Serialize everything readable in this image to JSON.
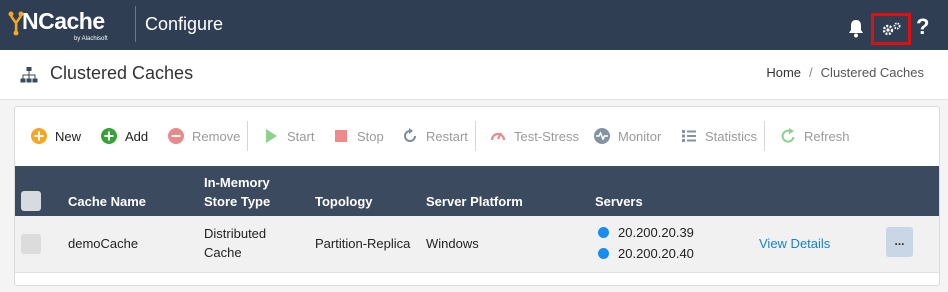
{
  "topbar": {
    "logo_text": "NCache",
    "logo_sub": "by Alachisoft",
    "app_title": "Configure",
    "help_label": "?"
  },
  "page": {
    "title": "Clustered Caches",
    "breadcrumb": {
      "home": "Home",
      "separator": "/",
      "current": "Clustered Caches"
    }
  },
  "toolbar": {
    "new": "New",
    "add": "Add",
    "remove": "Remove",
    "start": "Start",
    "stop": "Stop",
    "restart": "Restart",
    "test_stress": "Test-Stress",
    "monitor": "Monitor",
    "statistics": "Statistics",
    "refresh": "Refresh"
  },
  "table": {
    "headers": {
      "cache_name": "Cache Name",
      "store_type_1": "In-Memory",
      "store_type_2": "Store Type",
      "topology": "Topology",
      "server_platform": "Server Platform",
      "servers": "Servers"
    },
    "rows": [
      {
        "cache_name": "demoCache",
        "store_type_1": "Distributed",
        "store_type_2": "Cache",
        "topology": "Partition-Replica",
        "server_platform": "Windows",
        "servers": [
          "20.200.20.39",
          "20.200.20.40"
        ],
        "details_link": "View Details",
        "more": "..."
      }
    ]
  },
  "colors": {
    "topbar": "#2f3e52",
    "table_header": "#3b4a5e",
    "highlight": "#e01010",
    "link": "#1a7fd6",
    "server_dot": "#1a8cf0"
  }
}
